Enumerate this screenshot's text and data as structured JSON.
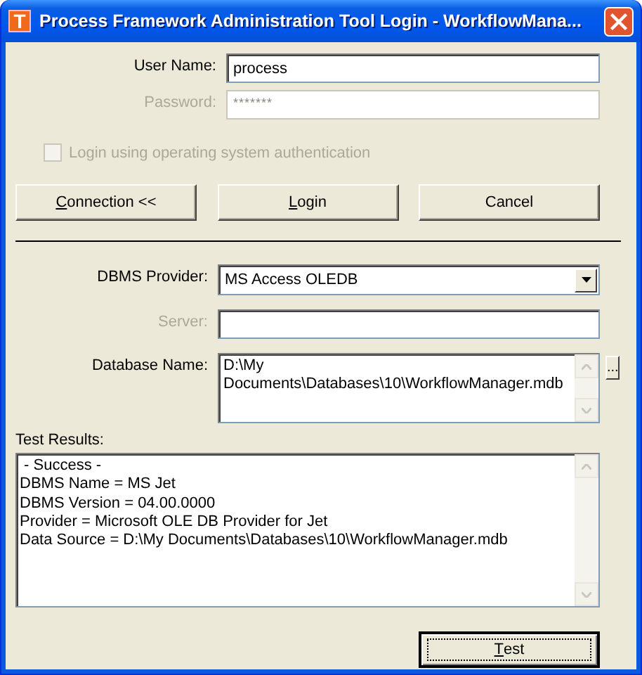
{
  "window": {
    "icon_letter": "T",
    "title": "Process Framework Administration Tool Login - WorkflowMana..."
  },
  "login": {
    "fields": [
      {
        "label": "User Name:",
        "value": "process",
        "disabled": false
      },
      {
        "label": "Password:",
        "value": "*******",
        "disabled": true
      }
    ],
    "os_auth": {
      "label": "Login using operating system authentication",
      "checked": false,
      "disabled": true
    },
    "buttons": [
      {
        "label": "Connection <<",
        "underline_first": true
      },
      {
        "label": "Login",
        "underline_first": true
      },
      {
        "label": "Cancel",
        "underline_first": false
      }
    ]
  },
  "connection": {
    "provider": {
      "label": "DBMS Provider:",
      "value": "MS Access OLEDB"
    },
    "server": {
      "label": "Server:",
      "disabled": true
    },
    "database": {
      "label": "Database Name:",
      "value": "D:\\My Documents\\Databases\\10\\WorkflowManager.mdb",
      "browse": "..."
    }
  },
  "results": {
    "label": "Test Results:",
    "lines": [
      " - Success -",
      "DBMS Name = MS Jet",
      "DBMS Version = 04.00.0000",
      "Provider = Microsoft OLE DB Provider for Jet",
      "Data Source = D:\\My Documents\\Databases\\10\\WorkflowManager.mdb"
    ]
  },
  "test_button": {
    "label": "Test",
    "underline_first": true,
    "default": true
  }
}
